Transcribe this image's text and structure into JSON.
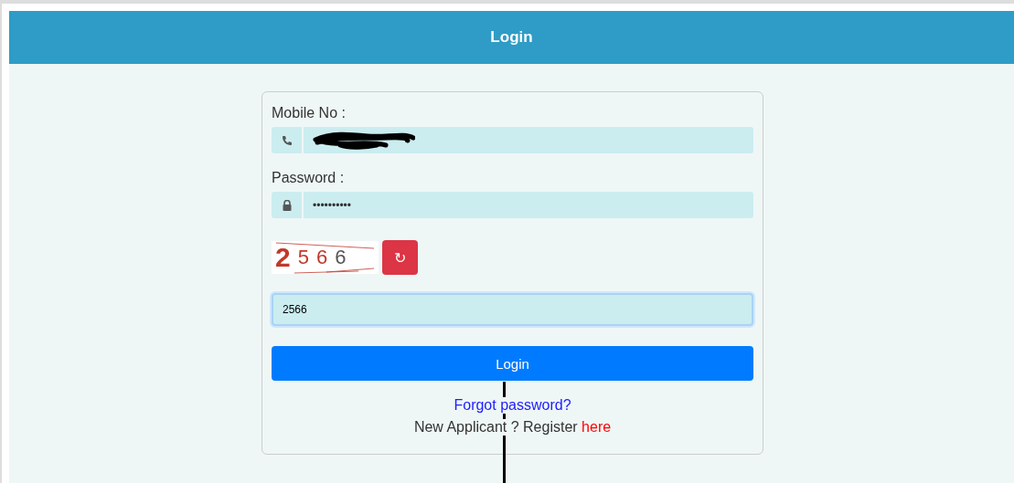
{
  "header": {
    "title": "Login"
  },
  "form": {
    "mobile": {
      "label": "Mobile No :",
      "redacted": true
    },
    "password": {
      "label": "Password :",
      "value": "••••••••••"
    },
    "captcha": {
      "characters": [
        "2",
        "5",
        "6",
        "6"
      ],
      "refresh": "↻"
    },
    "captcha_input": {
      "value": "2566",
      "focused": true
    },
    "submit": "Login",
    "forgot": "Forgot password?",
    "register": {
      "text": "New Applicant ? Register",
      "link": "here"
    }
  }
}
